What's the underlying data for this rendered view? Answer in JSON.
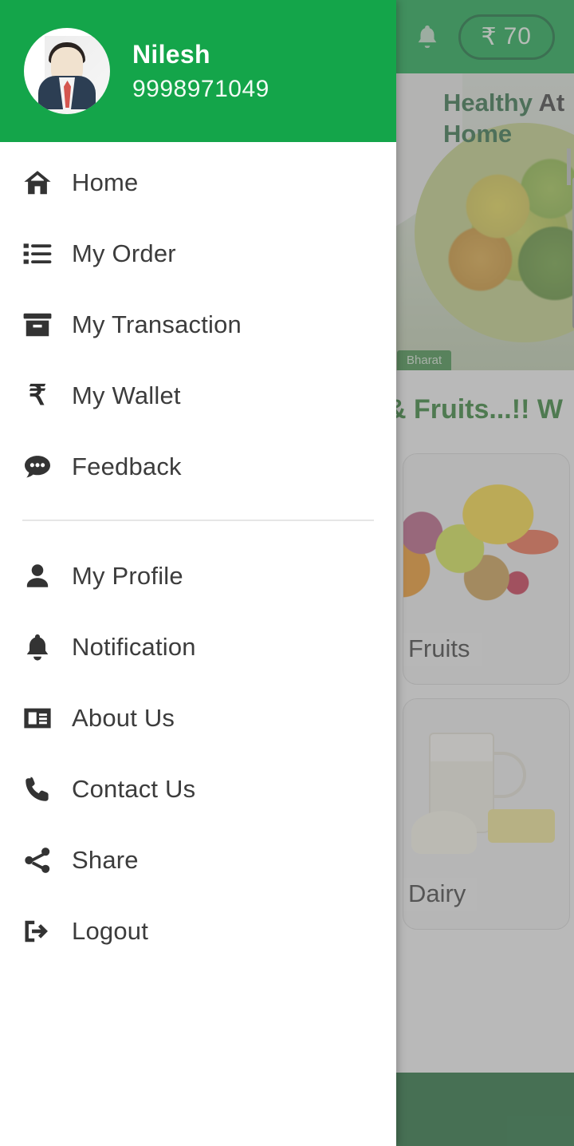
{
  "drawer": {
    "user": {
      "name": "Nilesh",
      "phone": "9998971049",
      "avatar_icon": "user-avatar-businessman"
    },
    "menu_primary": [
      {
        "label": "Home",
        "icon": "home-icon"
      },
      {
        "label": "My Order",
        "icon": "list-icon"
      },
      {
        "label": "My Transaction",
        "icon": "archive-box-icon"
      },
      {
        "label": "My Wallet",
        "icon": "rupee-icon",
        "glyph": "₹"
      },
      {
        "label": "Feedback",
        "icon": "comment-bubble-icon"
      }
    ],
    "menu_secondary": [
      {
        "label": "My Profile",
        "icon": "person-icon"
      },
      {
        "label": "Notification",
        "icon": "bell-icon"
      },
      {
        "label": "About Us",
        "icon": "id-card-icon"
      },
      {
        "label": "Contact Us",
        "icon": "phone-icon"
      },
      {
        "label": "Share",
        "icon": "share-nodes-icon"
      },
      {
        "label": "Logout",
        "icon": "sign-out-icon"
      }
    ]
  },
  "background_app": {
    "topbar": {
      "bell_icon": "bell-icon",
      "wallet_currency": "₹",
      "wallet_amount": "70"
    },
    "banner": {
      "title_line1_green": "Healthy",
      "title_line1_dark": "At",
      "title_line2": "Home",
      "chip_label": "Bharat"
    },
    "section_title": "...etables & Fruits...!! W",
    "cards": [
      {
        "label": "Fruits"
      },
      {
        "label": "Dairy"
      }
    ],
    "bottombar": {
      "arrow_icon": "arrow-right-icon"
    }
  },
  "colors": {
    "brand_green": "#14a54a",
    "topbar_green": "#15a24a",
    "bottombar_green": "#1f6b38",
    "banner_text_green": "#2c6b43",
    "section_title_green": "#2e7d32",
    "menu_text": "#3c3c3c",
    "drawer_bg": "#ffffff"
  }
}
